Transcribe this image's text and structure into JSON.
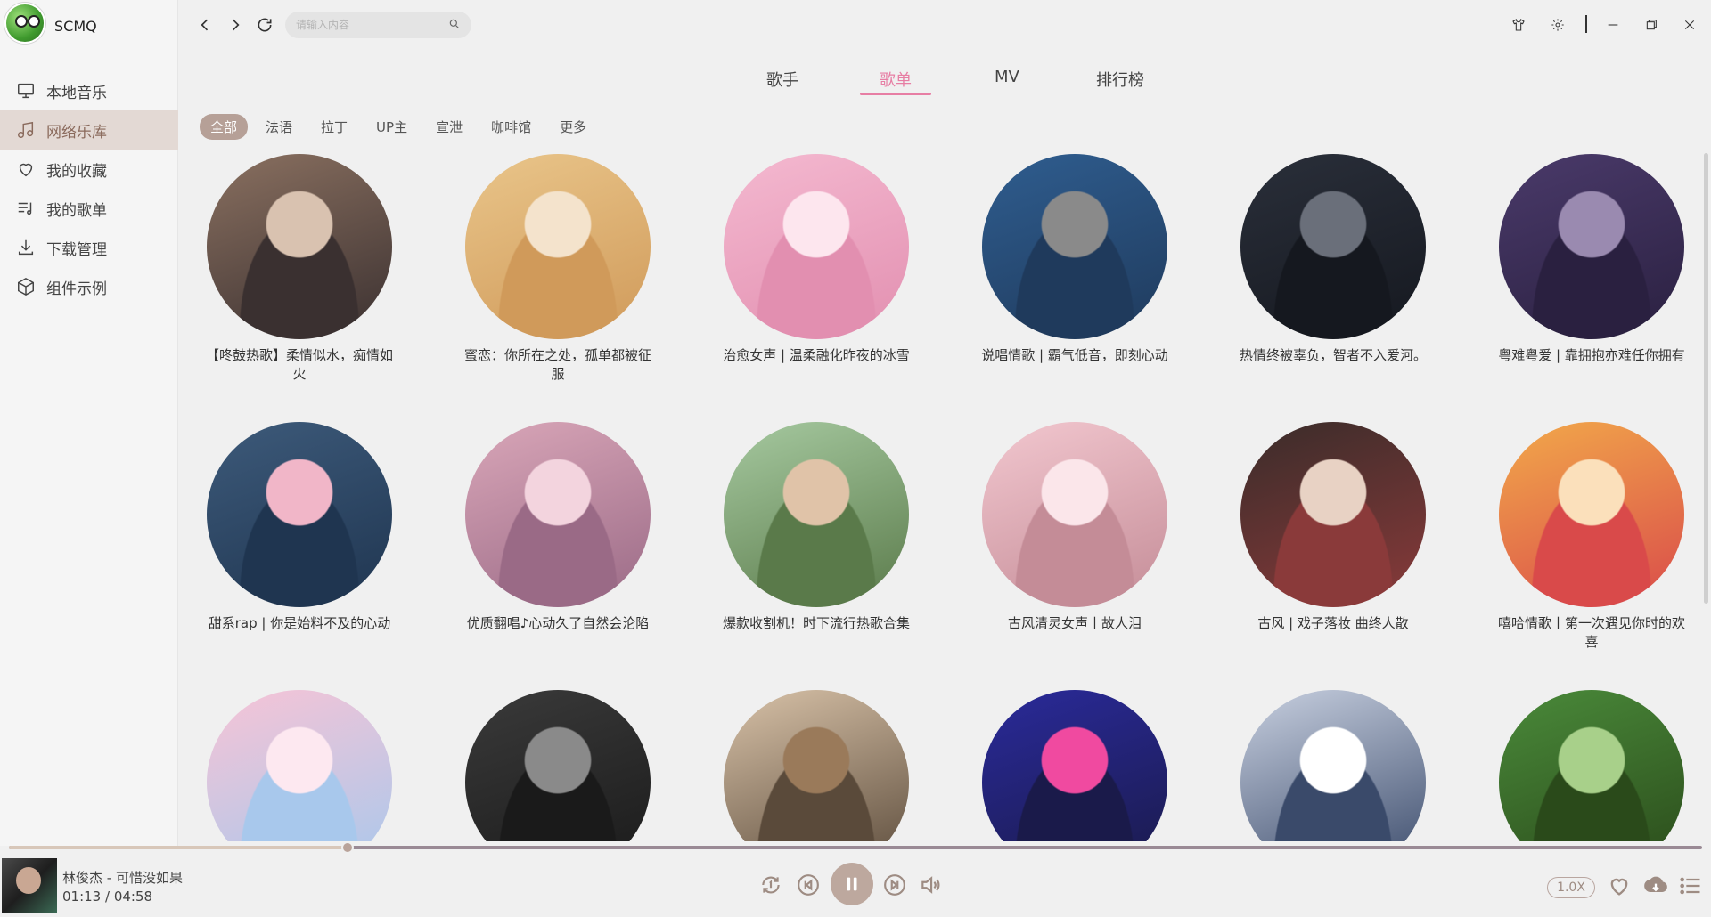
{
  "app": {
    "name": "SCMQ"
  },
  "sidebar": {
    "items": [
      {
        "label": "本地音乐",
        "icon": "monitor-icon",
        "active": false
      },
      {
        "label": "网络乐库",
        "icon": "music-note-icon",
        "active": true
      },
      {
        "label": "我的收藏",
        "icon": "heart-icon",
        "active": false
      },
      {
        "label": "我的歌单",
        "icon": "playlist-icon",
        "active": false
      },
      {
        "label": "下载管理",
        "icon": "download-icon",
        "active": false
      },
      {
        "label": "组件示例",
        "icon": "cube-icon",
        "active": false
      }
    ]
  },
  "search": {
    "placeholder": "请输入内容",
    "value": ""
  },
  "tabs": [
    {
      "label": "歌手",
      "active": false
    },
    {
      "label": "歌单",
      "active": true
    },
    {
      "label": "MV",
      "active": false
    },
    {
      "label": "排行榜",
      "active": false
    }
  ],
  "categories": [
    {
      "label": "全部",
      "active": true
    },
    {
      "label": "法语",
      "active": false
    },
    {
      "label": "拉丁",
      "active": false
    },
    {
      "label": "UP主",
      "active": false
    },
    {
      "label": "宣泄",
      "active": false
    },
    {
      "label": "咖啡馆",
      "active": false
    },
    {
      "label": "更多",
      "active": false
    }
  ],
  "playlists": [
    {
      "title": "【咚鼓热歌】柔情似水，痴情如火",
      "colors": [
        "#8a7060",
        "#d9c2b0",
        "#3a3030"
      ]
    },
    {
      "title": "蜜恋：你所在之处，孤单都被征服",
      "colors": [
        "#e9c58a",
        "#f4e3cc",
        "#d09a5a"
      ]
    },
    {
      "title": "治愈女声 | 温柔融化昨夜的冰雪",
      "colors": [
        "#f4b9d0",
        "#fde6ee",
        "#e28fb0"
      ]
    },
    {
      "title": "说唱情歌 | 霸气低音，即刻心动",
      "colors": [
        "#2f5d8f",
        "#8a8a8a",
        "#1f3a5c"
      ]
    },
    {
      "title": "热情终被辜负，智者不入爱河。",
      "colors": [
        "#2a2f3a",
        "#6a6f7a",
        "#15181f"
      ]
    },
    {
      "title": "粤难粤爱 | 靠拥抱亦难任你拥有",
      "colors": [
        "#4a3a6a",
        "#9a8ab0",
        "#2a2040"
      ]
    },
    {
      "title": "甜系rap | 你是始料不及的心动",
      "colors": [
        "#3d5a7a",
        "#f1b6c8",
        "#1f3550"
      ]
    },
    {
      "title": "优质翻唱♪心动久了自然会沦陷",
      "colors": [
        "#d9a6b8",
        "#f3d4de",
        "#9a6a86"
      ]
    },
    {
      "title": "爆款收割机！时下流行热歌合集",
      "colors": [
        "#a6c9a0",
        "#e0c3a8",
        "#5a7a4a"
      ]
    },
    {
      "title": "古风清灵女声丨故人泪",
      "colors": [
        "#f2c7cf",
        "#fbe6ea",
        "#c48c97"
      ]
    },
    {
      "title": "古风 | 戏子落妆 曲终人散",
      "colors": [
        "#3a2c2a",
        "#e8d2c4",
        "#8a3a3a"
      ]
    },
    {
      "title": "嘻哈情歌丨第一次遇见你时的欢喜",
      "colors": [
        "#f2a94a",
        "#fbe0bb",
        "#d94a4a"
      ]
    },
    {
      "title": "",
      "colors": [
        "#f7c4d6",
        "#fde8f0",
        "#a8c8ec"
      ]
    },
    {
      "title": "",
      "colors": [
        "#3a3a3a",
        "#8a8a8a",
        "#1a1a1a"
      ]
    },
    {
      "title": "",
      "colors": [
        "#d8c2a8",
        "#9a7a5a",
        "#5a4a3a"
      ]
    },
    {
      "title": "",
      "colors": [
        "#2a2a9a",
        "#f04aa0",
        "#1a1a4a"
      ]
    },
    {
      "title": "",
      "colors": [
        "#c8d0e0",
        "#ffffff",
        "#3a4a6a"
      ]
    },
    {
      "title": "",
      "colors": [
        "#4a8a3a",
        "#a8d08a",
        "#2a4a1a"
      ]
    }
  ],
  "player": {
    "song": "林俊杰 - 可惜没如果",
    "time": "01:13 / 04:58",
    "progress": 0.2,
    "speed": "1.0X"
  },
  "theme": {
    "accent": "#e77ea4",
    "brown": "#b6a097"
  }
}
